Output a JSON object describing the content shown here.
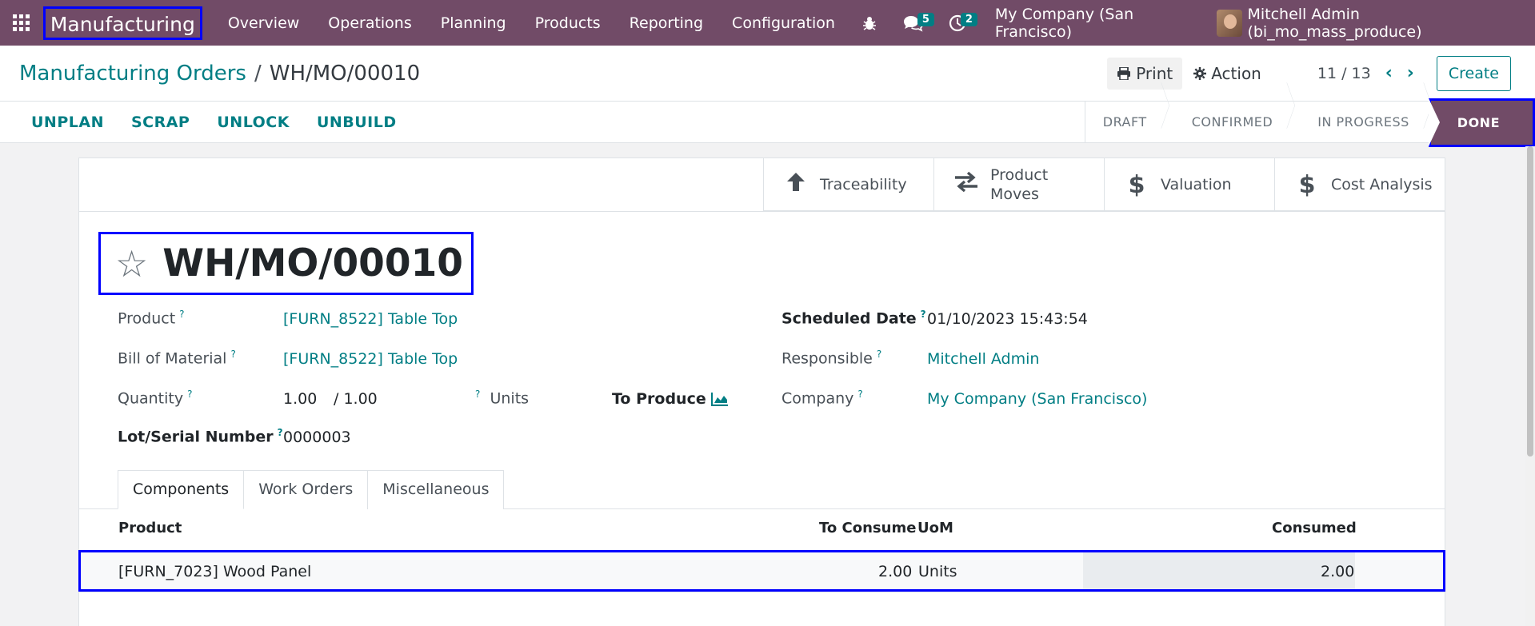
{
  "navbar": {
    "app_name": "Manufacturing",
    "menu": [
      "Overview",
      "Operations",
      "Planning",
      "Products",
      "Reporting",
      "Configuration"
    ],
    "chat_count": "5",
    "activity_count": "2",
    "company": "My Company (San Francisco)",
    "user": "Mitchell Admin (bi_mo_mass_produce)"
  },
  "control": {
    "breadcrumb_parent": "Manufacturing Orders",
    "breadcrumb_separator": "/",
    "breadcrumb_current": "WH/MO/00010",
    "print_label": "Print",
    "action_label": "Action",
    "pager": "11 / 13",
    "create_label": "Create"
  },
  "statusbar": {
    "actions": [
      "UNPLAN",
      "SCRAP",
      "UNLOCK",
      "UNBUILD"
    ],
    "stages": [
      "DRAFT",
      "CONFIRMED",
      "IN PROGRESS"
    ],
    "active_stage": "DONE"
  },
  "smart_buttons": {
    "traceability": "Traceability",
    "product_moves_1": "Product",
    "product_moves_2": "Moves",
    "valuation": "Valuation",
    "cost_analysis": "Cost Analysis"
  },
  "form": {
    "title": "WH/MO/00010",
    "product_label": "Product",
    "product_value": "[FURN_8522] Table Top",
    "bom_label": "Bill of Material",
    "bom_value": "[FURN_8522] Table Top",
    "quantity_label": "Quantity",
    "quantity_value": "1.00",
    "quantity_total": "/ 1.00",
    "quantity_uom": "Units",
    "to_produce_label": "To Produce",
    "lot_label": "Lot/Serial Number",
    "lot_value": "0000003",
    "scheduled_label": "Scheduled Date",
    "scheduled_value": "01/10/2023 15:43:54",
    "responsible_label": "Responsible",
    "responsible_value": "Mitchell Admin",
    "company_label": "Company",
    "company_value": "My Company (San Francisco)",
    "help_mark": "?"
  },
  "tabs": [
    "Components",
    "Work Orders",
    "Miscellaneous"
  ],
  "table": {
    "headers": {
      "product": "Product",
      "to_consume": "To Consume",
      "uom": "UoM",
      "consumed": "Consumed"
    },
    "rows": [
      {
        "product": "[FURN_7023] Wood Panel",
        "to_consume": "2.00",
        "uom": "Units",
        "consumed": "2.00"
      }
    ]
  }
}
